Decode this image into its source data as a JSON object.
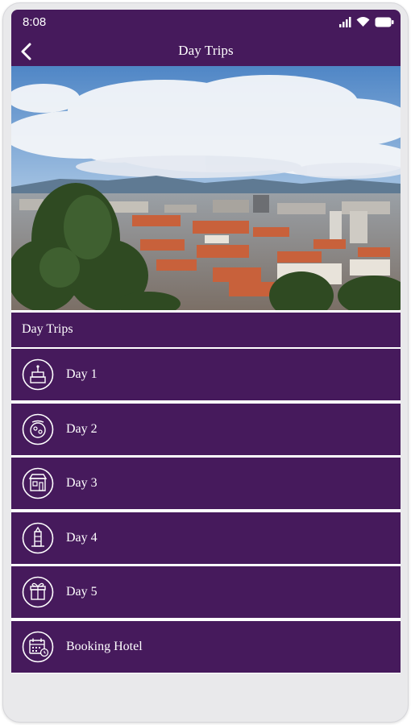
{
  "status": {
    "time": "8:08"
  },
  "appbar": {
    "title": "Day Trips"
  },
  "hero": {
    "alt": "Panoramic view of city with red rooftops and trees"
  },
  "section": {
    "title": "Day Trips"
  },
  "menu": {
    "items": [
      {
        "label": "Day 1",
        "icon": "cake-icon"
      },
      {
        "label": "Day 2",
        "icon": "food-icon"
      },
      {
        "label": "Day 3",
        "icon": "shop-icon"
      },
      {
        "label": "Day 4",
        "icon": "tower-icon"
      },
      {
        "label": "Day 5",
        "icon": "gift-icon"
      },
      {
        "label": "Booking Hotel",
        "icon": "calendar-icon"
      }
    ]
  },
  "colors": {
    "primary": "#461a5c",
    "divider": "#e9e9eb",
    "text": "#ffffff"
  }
}
